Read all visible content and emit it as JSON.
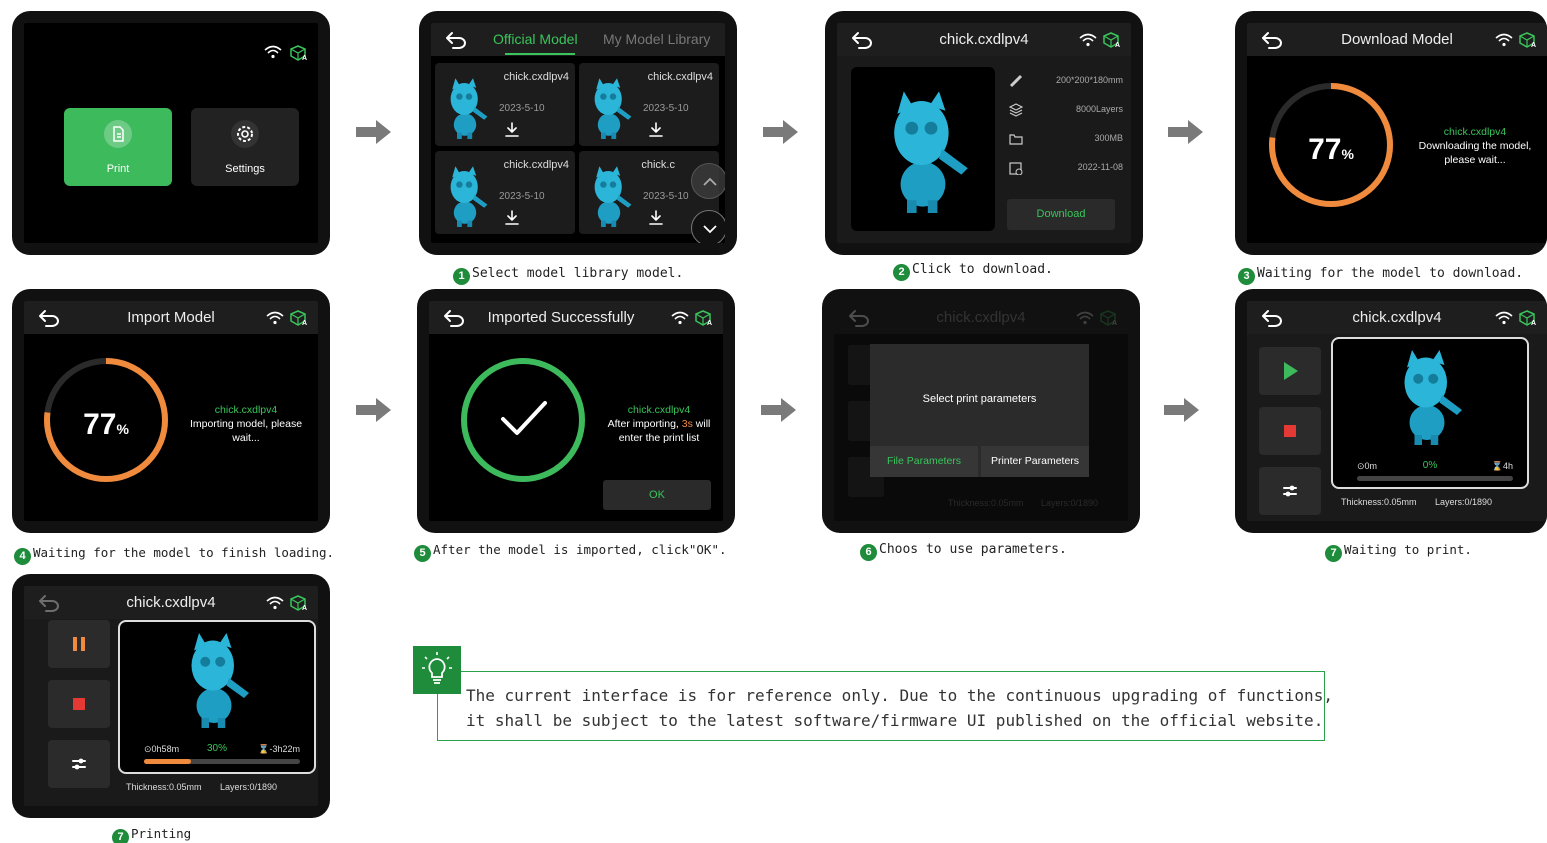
{
  "status_icons": {
    "wifi": "wifi-icon",
    "cube": "cube-a-icon"
  },
  "screen1": {
    "print_label": "Print",
    "settings_label": "Settings"
  },
  "screen2": {
    "tab_official": "Official Model",
    "tab_library": "My Model Library",
    "cards": [
      {
        "name": "chick.cxdlpv4",
        "date": "2023-5-10"
      },
      {
        "name": "chick.cxdlpv4",
        "date": "2023-5-10"
      },
      {
        "name": "chick.cxdlpv4",
        "date": "2023-5-10"
      },
      {
        "name": "chick.c",
        "date": "2023-5-10"
      }
    ],
    "caption": "Select model library model.",
    "step": "1"
  },
  "screen3": {
    "title": "chick.cxdlpv4",
    "size": "200*200*180mm",
    "layers": "8000Layers",
    "file_size": "300MB",
    "date": "2022-11-08",
    "download_label": "Download",
    "caption": "Click to download.",
    "step": "2"
  },
  "screen4": {
    "title": "Download Model",
    "percent": "77",
    "percent_unit": "%",
    "progress": 0.77,
    "filename": "chick.cxdlpv4",
    "msg1": "Downloading the model,",
    "msg2": "please wait...",
    "caption": "Waiting for the model to download.",
    "step": "3"
  },
  "screen5": {
    "title": "Import Model",
    "percent": "77",
    "percent_unit": "%",
    "progress": 0.77,
    "filename": "chick.cxdlpv4",
    "msg1": "Importing model, please",
    "msg2": "wait...",
    "caption": "Waiting for the model to finish loading.",
    "step": "4"
  },
  "screen6": {
    "title": "Imported Successfully",
    "filename": "chick.cxdlpv4",
    "msg1_pre": "After importing, ",
    "msg1_sec": "3s",
    "msg1_post": " will",
    "msg2": "enter the print list",
    "ok_label": "OK",
    "caption": "After the model is imported, click\"OK\".",
    "step": "5"
  },
  "screen7": {
    "title": "chick.cxdlpv4",
    "dialog_title": "Select print parameters",
    "file_params": "File Parameters",
    "printer_params": "Printer Parameters",
    "thickness": "Thickness:0.05mm",
    "layers": "Layers:0/1890",
    "caption": "Choos to use parameters.",
    "step": "6"
  },
  "screen8": {
    "title": "chick.cxdlpv4",
    "elapsed": "0m",
    "percent": "0%",
    "remaining": "4h",
    "progress": 0,
    "thickness": "Thickness:0.05mm",
    "layers": "Layers:0/1890",
    "caption": "Waiting to print.",
    "step": "7"
  },
  "screen9": {
    "title": "chick.cxdlpv4",
    "elapsed": "0h58m",
    "percent": "30%",
    "remaining": "-3h22m",
    "progress": 0.3,
    "thickness": "Thickness:0.05mm",
    "layers": "Layers:0/1890",
    "caption": "Printing",
    "step": "7"
  },
  "tip": {
    "line1": "The current interface is for reference only. Due to the continuous upgrading of functions,",
    "line2": "it shall be subject to the latest software/firmware UI published on the official website."
  },
  "colors": {
    "accent_green": "#39c55b",
    "orange": "#f08a3c",
    "model_blue": "#2bb5d8"
  }
}
